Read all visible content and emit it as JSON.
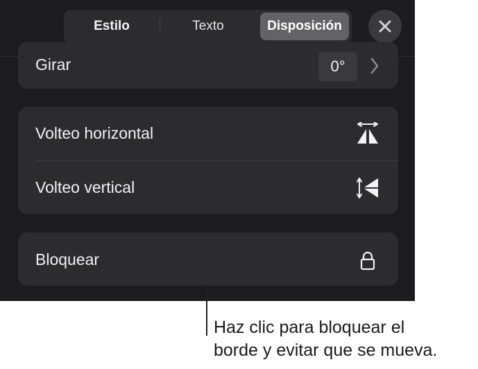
{
  "tabs": [
    {
      "label": "Estilo",
      "selected": false
    },
    {
      "label": "Texto",
      "selected": false
    },
    {
      "label": "Disposición",
      "selected": true
    }
  ],
  "close_icon": "close-icon",
  "rotate": {
    "label": "Girar",
    "value": "0°",
    "icon": "chevron-right-icon"
  },
  "flip": {
    "horizontal_label": "Volteo horizontal",
    "horizontal_icon": "flip-horizontal-icon",
    "vertical_label": "Volteo vertical",
    "vertical_icon": "flip-vertical-icon"
  },
  "lock": {
    "label": "Bloquear",
    "icon": "lock-icon"
  },
  "callout": {
    "line1": "Haz clic para bloquear el",
    "line2": "borde y evitar que se mueva."
  },
  "colors": {
    "panel_background": "#1c1c1e",
    "card_background": "#2c2c2e",
    "selected_tab": "#636366",
    "text": "#f2f2f7"
  }
}
